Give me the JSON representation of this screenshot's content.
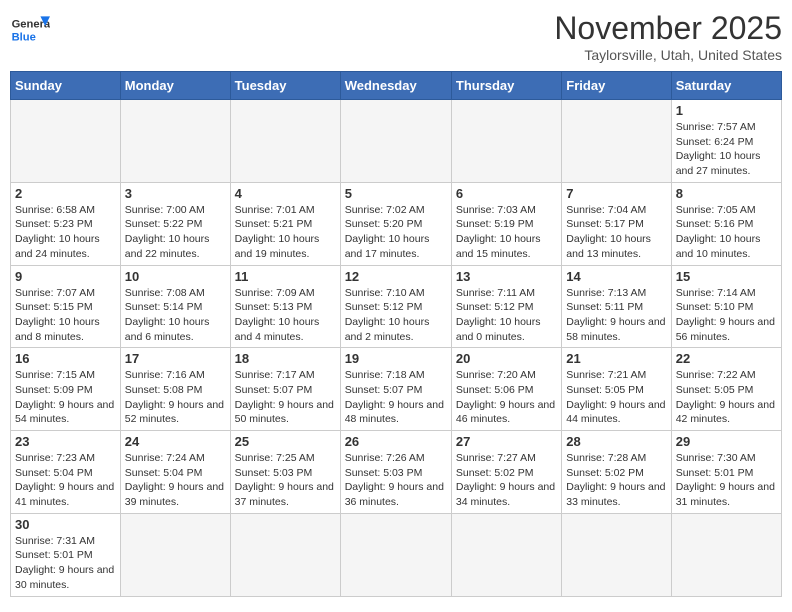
{
  "header": {
    "logo_line1": "General",
    "logo_line2": "Blue",
    "month_title": "November 2025",
    "location": "Taylorsville, Utah, United States"
  },
  "weekdays": [
    "Sunday",
    "Monday",
    "Tuesday",
    "Wednesday",
    "Thursday",
    "Friday",
    "Saturday"
  ],
  "weeks": [
    [
      {
        "day": "",
        "info": ""
      },
      {
        "day": "",
        "info": ""
      },
      {
        "day": "",
        "info": ""
      },
      {
        "day": "",
        "info": ""
      },
      {
        "day": "",
        "info": ""
      },
      {
        "day": "",
        "info": ""
      },
      {
        "day": "1",
        "info": "Sunrise: 7:57 AM\nSunset: 6:24 PM\nDaylight: 10 hours and 27 minutes."
      }
    ],
    [
      {
        "day": "2",
        "info": "Sunrise: 6:58 AM\nSunset: 5:23 PM\nDaylight: 10 hours and 24 minutes."
      },
      {
        "day": "3",
        "info": "Sunrise: 7:00 AM\nSunset: 5:22 PM\nDaylight: 10 hours and 22 minutes."
      },
      {
        "day": "4",
        "info": "Sunrise: 7:01 AM\nSunset: 5:21 PM\nDaylight: 10 hours and 19 minutes."
      },
      {
        "day": "5",
        "info": "Sunrise: 7:02 AM\nSunset: 5:20 PM\nDaylight: 10 hours and 17 minutes."
      },
      {
        "day": "6",
        "info": "Sunrise: 7:03 AM\nSunset: 5:19 PM\nDaylight: 10 hours and 15 minutes."
      },
      {
        "day": "7",
        "info": "Sunrise: 7:04 AM\nSunset: 5:17 PM\nDaylight: 10 hours and 13 minutes."
      },
      {
        "day": "8",
        "info": "Sunrise: 7:05 AM\nSunset: 5:16 PM\nDaylight: 10 hours and 10 minutes."
      }
    ],
    [
      {
        "day": "9",
        "info": "Sunrise: 7:07 AM\nSunset: 5:15 PM\nDaylight: 10 hours and 8 minutes."
      },
      {
        "day": "10",
        "info": "Sunrise: 7:08 AM\nSunset: 5:14 PM\nDaylight: 10 hours and 6 minutes."
      },
      {
        "day": "11",
        "info": "Sunrise: 7:09 AM\nSunset: 5:13 PM\nDaylight: 10 hours and 4 minutes."
      },
      {
        "day": "12",
        "info": "Sunrise: 7:10 AM\nSunset: 5:12 PM\nDaylight: 10 hours and 2 minutes."
      },
      {
        "day": "13",
        "info": "Sunrise: 7:11 AM\nSunset: 5:12 PM\nDaylight: 10 hours and 0 minutes."
      },
      {
        "day": "14",
        "info": "Sunrise: 7:13 AM\nSunset: 5:11 PM\nDaylight: 9 hours and 58 minutes."
      },
      {
        "day": "15",
        "info": "Sunrise: 7:14 AM\nSunset: 5:10 PM\nDaylight: 9 hours and 56 minutes."
      }
    ],
    [
      {
        "day": "16",
        "info": "Sunrise: 7:15 AM\nSunset: 5:09 PM\nDaylight: 9 hours and 54 minutes."
      },
      {
        "day": "17",
        "info": "Sunrise: 7:16 AM\nSunset: 5:08 PM\nDaylight: 9 hours and 52 minutes."
      },
      {
        "day": "18",
        "info": "Sunrise: 7:17 AM\nSunset: 5:07 PM\nDaylight: 9 hours and 50 minutes."
      },
      {
        "day": "19",
        "info": "Sunrise: 7:18 AM\nSunset: 5:07 PM\nDaylight: 9 hours and 48 minutes."
      },
      {
        "day": "20",
        "info": "Sunrise: 7:20 AM\nSunset: 5:06 PM\nDaylight: 9 hours and 46 minutes."
      },
      {
        "day": "21",
        "info": "Sunrise: 7:21 AM\nSunset: 5:05 PM\nDaylight: 9 hours and 44 minutes."
      },
      {
        "day": "22",
        "info": "Sunrise: 7:22 AM\nSunset: 5:05 PM\nDaylight: 9 hours and 42 minutes."
      }
    ],
    [
      {
        "day": "23",
        "info": "Sunrise: 7:23 AM\nSunset: 5:04 PM\nDaylight: 9 hours and 41 minutes."
      },
      {
        "day": "24",
        "info": "Sunrise: 7:24 AM\nSunset: 5:04 PM\nDaylight: 9 hours and 39 minutes."
      },
      {
        "day": "25",
        "info": "Sunrise: 7:25 AM\nSunset: 5:03 PM\nDaylight: 9 hours and 37 minutes."
      },
      {
        "day": "26",
        "info": "Sunrise: 7:26 AM\nSunset: 5:03 PM\nDaylight: 9 hours and 36 minutes."
      },
      {
        "day": "27",
        "info": "Sunrise: 7:27 AM\nSunset: 5:02 PM\nDaylight: 9 hours and 34 minutes."
      },
      {
        "day": "28",
        "info": "Sunrise: 7:28 AM\nSunset: 5:02 PM\nDaylight: 9 hours and 33 minutes."
      },
      {
        "day": "29",
        "info": "Sunrise: 7:30 AM\nSunset: 5:01 PM\nDaylight: 9 hours and 31 minutes."
      }
    ],
    [
      {
        "day": "30",
        "info": "Sunrise: 7:31 AM\nSunset: 5:01 PM\nDaylight: 9 hours and 30 minutes."
      },
      {
        "day": "",
        "info": ""
      },
      {
        "day": "",
        "info": ""
      },
      {
        "day": "",
        "info": ""
      },
      {
        "day": "",
        "info": ""
      },
      {
        "day": "",
        "info": ""
      },
      {
        "day": "",
        "info": ""
      }
    ]
  ]
}
